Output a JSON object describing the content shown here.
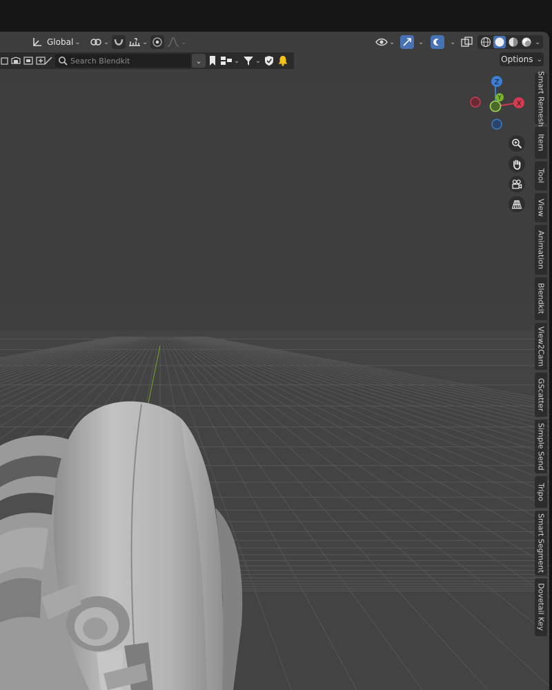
{
  "header": {
    "orientation_label": "Global",
    "orientation_icon": "transform-orientation-icon",
    "pivot_icon": "pivot-link-icon",
    "snap_icon": "snap-magnet-icon",
    "snap_target_icon": "snap-increment-icon",
    "proportional_icon": "proportional-edit-icon",
    "falloff_icon": "falloff-curve-icon",
    "visibility_icon": "object-visibility-icon",
    "gizmo_icon": "gizmo-toggle-icon",
    "overlay_icon": "overlay-toggle-icon",
    "xray_icon": "xray-toggle-icon",
    "shading_modes": [
      "wireframe",
      "solid",
      "material",
      "rendered"
    ],
    "active_shading": "solid"
  },
  "toolbar": {
    "search_placeholder": "Search Blendkit",
    "options_label": "Options",
    "icons": [
      "select-box-icon",
      "select-lasso-icon",
      "cursor-icon",
      "transform-icon",
      "annotate-icon"
    ],
    "right_icons": [
      "dropdown-icon",
      "bookmark-icon",
      "asset-type-icon",
      "filter-icon",
      "shield-check-icon",
      "bell-icon"
    ]
  },
  "tabs": [
    "Smart Remesh",
    "Item",
    "Tool",
    "View",
    "Animation",
    "Blendkit",
    "View2Cam",
    "GScatter",
    "Simple Send",
    "Tripo",
    "Smart Segment",
    "Dovetail Key"
  ],
  "gizmo": {
    "z_label": "Z",
    "y_label": "Y",
    "x_label": "X",
    "colors": {
      "x": "#d43b52",
      "y": "#76b82a",
      "z": "#3b7fd4"
    }
  },
  "nav_buttons": [
    "zoom-icon",
    "hand-pan-icon",
    "camera-view-icon",
    "perspective-grid-icon"
  ]
}
